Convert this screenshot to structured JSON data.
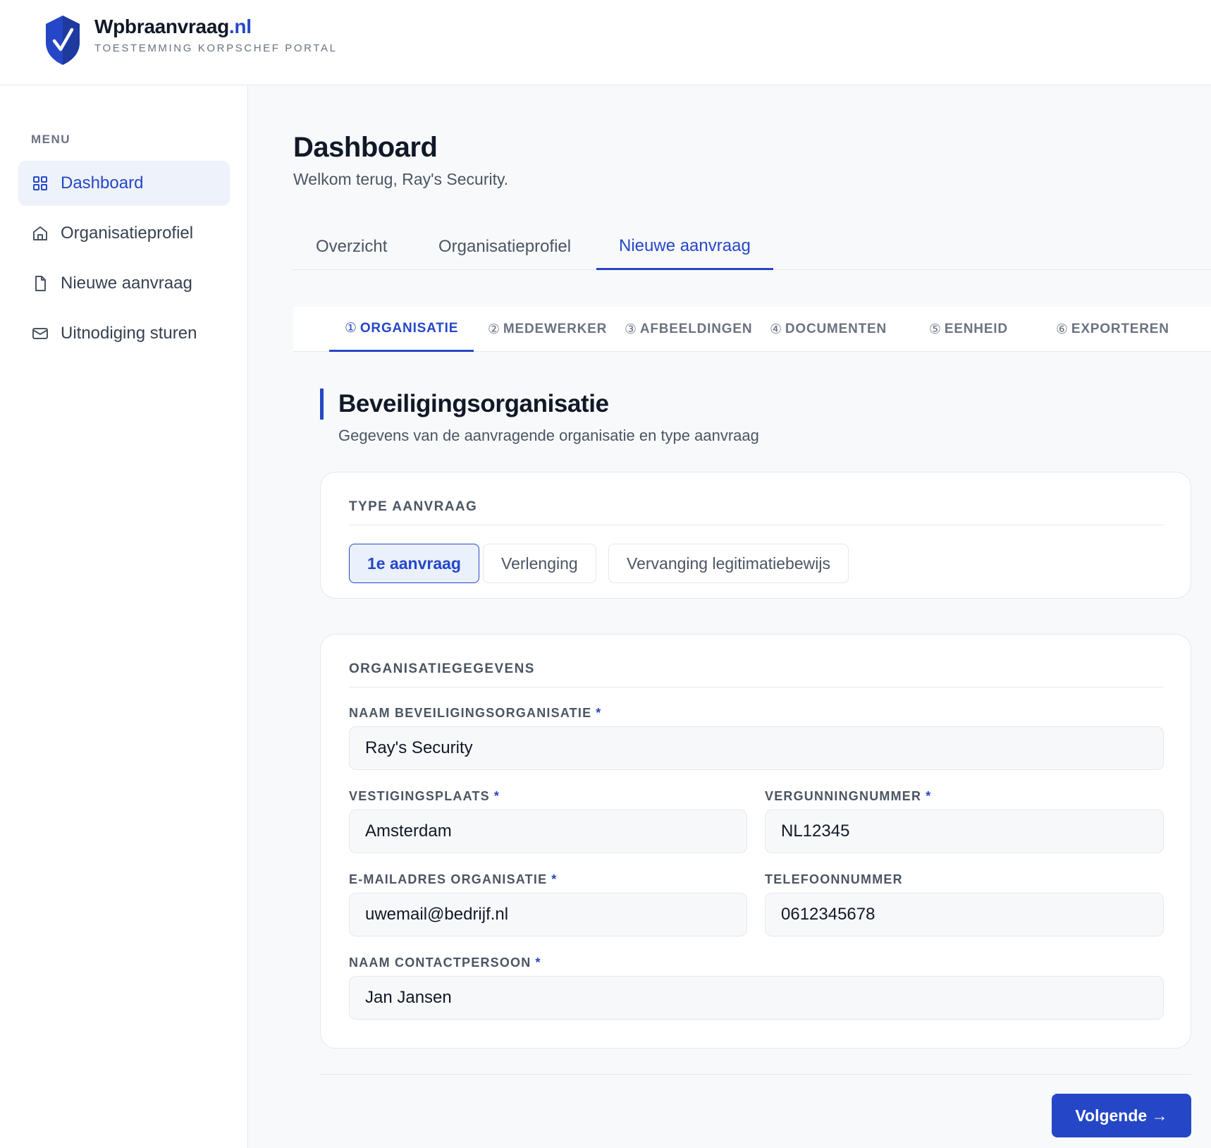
{
  "brand": {
    "name": "Wpbraanvraag",
    "tld": ".nl",
    "subtitle": "TOESTEMMING KORPSCHEF PORTAL",
    "accent_color": "#2547c7"
  },
  "sidebar": {
    "menu_label": "MENU",
    "items": [
      {
        "label": "Dashboard",
        "icon": "grid-icon",
        "active": true
      },
      {
        "label": "Organisatieprofiel",
        "icon": "home-icon",
        "active": false
      },
      {
        "label": "Nieuwe aanvraag",
        "icon": "file-icon",
        "active": false
      },
      {
        "label": "Uitnodiging sturen",
        "icon": "mail-icon",
        "active": false
      }
    ]
  },
  "main": {
    "title": "Dashboard",
    "subtitle": "Welkom terug, Ray's Security.",
    "tabs": [
      {
        "label": "Overzicht",
        "active": false
      },
      {
        "label": "Organisatieprofiel",
        "active": false
      },
      {
        "label": "Nieuwe aanvraag",
        "active": true
      }
    ],
    "steps": [
      {
        "num": "①",
        "label": "ORGANISATIE",
        "active": true
      },
      {
        "num": "②",
        "label": "MEDEWERKER",
        "active": false
      },
      {
        "num": "③",
        "label": "AFBEELDINGEN",
        "active": false
      },
      {
        "num": "④",
        "label": "DOCUMENTEN",
        "active": false
      },
      {
        "num": "⑤",
        "label": "EENHEID",
        "active": false
      },
      {
        "num": "⑥",
        "label": "EXPORTEREN",
        "active": false
      }
    ],
    "section": {
      "title": "Beveiligingsorganisatie",
      "subtitle": "Gegevens van de aanvragende organisatie en type aanvraag"
    },
    "type_card": {
      "heading": "TYPE AANVRAAG",
      "options": [
        {
          "label": "1e aanvraag",
          "selected": true
        },
        {
          "label": "Verlenging",
          "selected": false
        },
        {
          "label": "Vervanging legitimatiebewijs",
          "selected": false
        }
      ]
    },
    "org_card": {
      "heading": "ORGANISATIEGEGEVENS",
      "required_mark": "*",
      "fields": {
        "naam": {
          "label": "NAAM BEVEILIGINGSORGANISATIE",
          "value": "Ray's Security",
          "required": true
        },
        "plaats": {
          "label": "VESTIGINGSPLAATS",
          "value": "Amsterdam",
          "required": true
        },
        "vergunning": {
          "label": "VERGUNNINGNUMMER",
          "value": "NL12345",
          "required": true
        },
        "email": {
          "label": "E-MAILADRES ORGANISATIE",
          "value": "uwemail@bedrijf.nl",
          "required": true
        },
        "telefoon": {
          "label": "TELEFOONNUMMER",
          "value": "0612345678",
          "required": false
        },
        "contact": {
          "label": "NAAM CONTACTPERSOON",
          "value": "Jan Jansen",
          "required": true
        }
      }
    },
    "next_button": "Volgende →"
  }
}
